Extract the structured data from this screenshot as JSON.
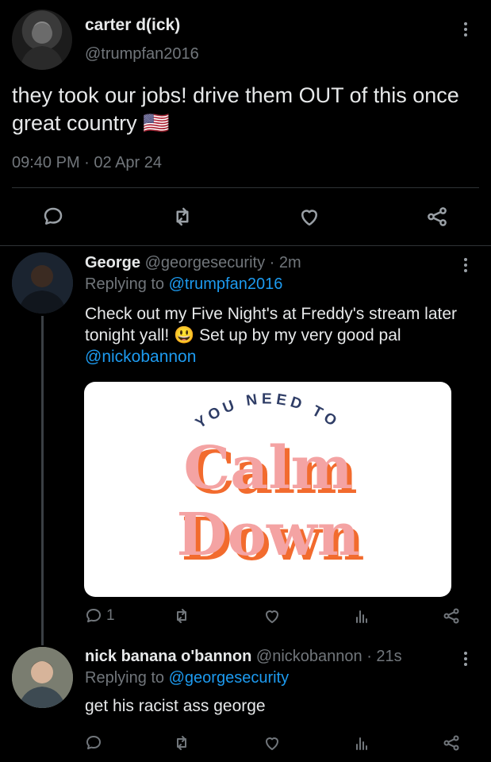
{
  "main_tweet": {
    "display_name": "carter d(ick)",
    "handle": "@trumpfan2016",
    "text": "they took our jobs! drive them OUT of this once great country",
    "emoji": "🇺🇸",
    "timestamp": "09:40 PM · 02 Apr 24",
    "actions": [
      "reply-icon",
      "retweet-icon",
      "like-icon",
      "share-icon"
    ]
  },
  "replies": [
    {
      "display_name": "George",
      "handle": "@georgesecurity",
      "time": "· 2m",
      "replying_prefix": "Replying to",
      "replying_to": "@trumpfan2016",
      "text_part1": "Check out my Five Night's at Freddy's stream later tonight yall!",
      "emoji": "😃",
      "text_part2": "Set up by my very good pal",
      "mention": "@nickobannon",
      "image": {
        "top_text": "YOU NEED TO",
        "line1": "Calm",
        "line2": "Down"
      },
      "reply_count": "1"
    },
    {
      "display_name": "nick banana o'bannon",
      "handle": "@nickobannon",
      "time": "· 21s",
      "replying_prefix": "Replying to",
      "replying_to": "@georgesecurity",
      "text": "get his racist ass george"
    }
  ],
  "colors": {
    "background": "#000000",
    "text": "#e7e9ea",
    "muted": "#71767b",
    "link": "#1d9bf0",
    "divider": "#2f3336",
    "image_pink": "#f4a3a3",
    "image_orange": "#f26b2e",
    "image_navy": "#2f3d66"
  }
}
